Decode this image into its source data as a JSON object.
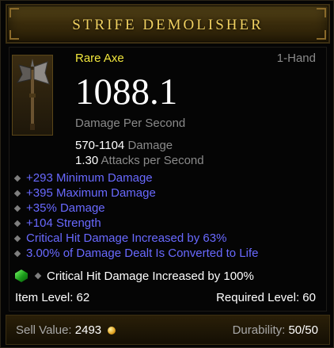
{
  "item": {
    "name": "STRIFE DEMOLISHER",
    "type": "Rare Axe",
    "slot": "1-Hand",
    "icon": "axe-icon",
    "dps": "1088.1",
    "dps_label": "Damage Per Second",
    "damage_range": "570-1104",
    "damage_label": "Damage",
    "attack_speed": "1.30",
    "attack_speed_label": "Attacks per Second"
  },
  "affixes": [
    "+293 Minimum Damage",
    "+395 Maximum Damage",
    "+35% Damage",
    "+104 Strength",
    "Critical Hit Damage Increased by 63%",
    "3.00% of Damage Dealt Is Converted to Life"
  ],
  "socket": {
    "gem_icon": "emerald-gem-icon",
    "text": "Critical Hit Damage Increased by 100%"
  },
  "levels": {
    "item_level": "Item Level: 62",
    "required_level": "Required Level: 60"
  },
  "footer": {
    "sell_label": "Sell Value:",
    "sell_value": "2493",
    "durability_label": "Durability:",
    "durability_value": "50/50"
  },
  "colors": {
    "title": "#f0d060",
    "rare": "#f1e63c",
    "magic_affix": "#6969ff",
    "muted": "#8a8a8a"
  }
}
